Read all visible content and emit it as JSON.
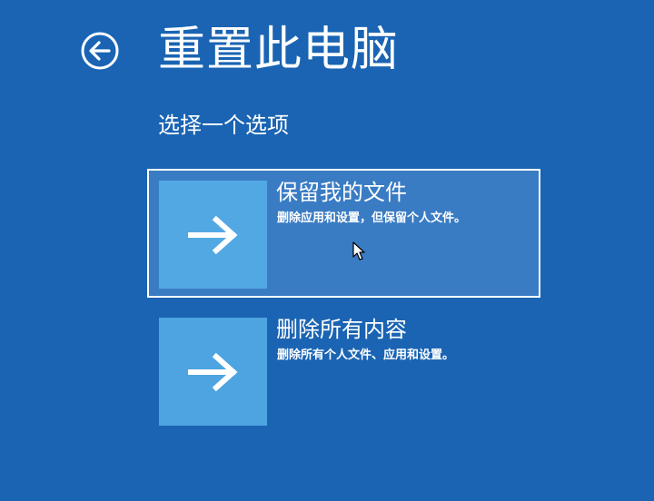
{
  "header": {
    "back_icon": "back-arrow-circle-icon",
    "title": "重置此电脑",
    "subtitle": "选择一个选项"
  },
  "options": [
    {
      "title": "保留我的文件",
      "description": "删除应用和设置，但保留个人文件。",
      "icon": "arrow-right-icon",
      "selected": true
    },
    {
      "title": "删除所有内容",
      "description": "删除所有个人文件、应用和设置。",
      "icon": "arrow-right-icon",
      "selected": false
    }
  ],
  "colors": {
    "background": "#1a64b3",
    "selected_option": "#3a7cc4",
    "tile": "#4ea4e0",
    "text": "#ffffff"
  }
}
